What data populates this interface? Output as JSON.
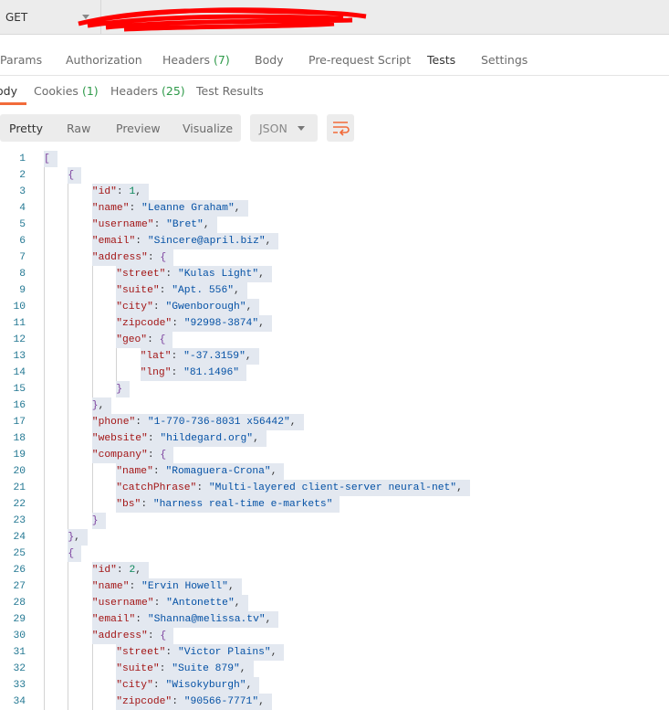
{
  "request": {
    "method": "GET"
  },
  "request_tabs": [
    {
      "label": "Params",
      "count": ""
    },
    {
      "label": "Authorization",
      "count": ""
    },
    {
      "label": "Headers",
      "count": "(7)"
    },
    {
      "label": "Body",
      "count": ""
    },
    {
      "label": "Pre-request Script",
      "count": ""
    },
    {
      "label": "Tests",
      "count": "",
      "active": true
    },
    {
      "label": "Settings",
      "count": ""
    }
  ],
  "response_tabs": [
    {
      "label": "ody",
      "count": "",
      "active": true
    },
    {
      "label": "Cookies",
      "count": "(1)"
    },
    {
      "label": "Headers",
      "count": "(25)"
    },
    {
      "label": "Test Results",
      "count": ""
    }
  ],
  "view_modes": [
    "Pretty",
    "Raw",
    "Preview",
    "Visualize"
  ],
  "active_view": "Pretty",
  "format": "JSON",
  "colors": {
    "accent": "#f26b3a",
    "count": "#2f9a4a",
    "key": "#a31515",
    "string": "#0451a5",
    "number": "#098658"
  },
  "icons": {
    "wrap": "wrap-lines-icon",
    "format_caret": "chevron-down-icon"
  },
  "code_lines": [
    {
      "i": 0,
      "t": "["
    },
    {
      "i": 1,
      "t": "{"
    },
    {
      "i": 2,
      "t": "\"id\": 1,"
    },
    {
      "i": 2,
      "t": "\"name\": \"Leanne Graham\","
    },
    {
      "i": 2,
      "t": "\"username\": \"Bret\","
    },
    {
      "i": 2,
      "t": "\"email\": \"Sincere@april.biz\","
    },
    {
      "i": 2,
      "t": "\"address\": {"
    },
    {
      "i": 3,
      "t": "\"street\": \"Kulas Light\","
    },
    {
      "i": 3,
      "t": "\"suite\": \"Apt. 556\","
    },
    {
      "i": 3,
      "t": "\"city\": \"Gwenborough\","
    },
    {
      "i": 3,
      "t": "\"zipcode\": \"92998-3874\","
    },
    {
      "i": 3,
      "t": "\"geo\": {"
    },
    {
      "i": 4,
      "t": "\"lat\": \"-37.3159\","
    },
    {
      "i": 4,
      "t": "\"lng\": \"81.1496\""
    },
    {
      "i": 3,
      "t": "}"
    },
    {
      "i": 2,
      "t": "},"
    },
    {
      "i": 2,
      "t": "\"phone\": \"1-770-736-8031 x56442\","
    },
    {
      "i": 2,
      "t": "\"website\": \"hildegard.org\","
    },
    {
      "i": 2,
      "t": "\"company\": {"
    },
    {
      "i": 3,
      "t": "\"name\": \"Romaguera-Crona\","
    },
    {
      "i": 3,
      "t": "\"catchPhrase\": \"Multi-layered client-server neural-net\","
    },
    {
      "i": 3,
      "t": "\"bs\": \"harness real-time e-markets\""
    },
    {
      "i": 2,
      "t": "}"
    },
    {
      "i": 1,
      "t": "},"
    },
    {
      "i": 1,
      "t": "{"
    },
    {
      "i": 2,
      "t": "\"id\": 2,"
    },
    {
      "i": 2,
      "t": "\"name\": \"Ervin Howell\","
    },
    {
      "i": 2,
      "t": "\"username\": \"Antonette\","
    },
    {
      "i": 2,
      "t": "\"email\": \"Shanna@melissa.tv\","
    },
    {
      "i": 2,
      "t": "\"address\": {"
    },
    {
      "i": 3,
      "t": "\"street\": \"Victor Plains\","
    },
    {
      "i": 3,
      "t": "\"suite\": \"Suite 879\","
    },
    {
      "i": 3,
      "t": "\"city\": \"Wisokyburgh\","
    },
    {
      "i": 3,
      "t": "\"zipcode\": \"90566-7771\","
    }
  ]
}
